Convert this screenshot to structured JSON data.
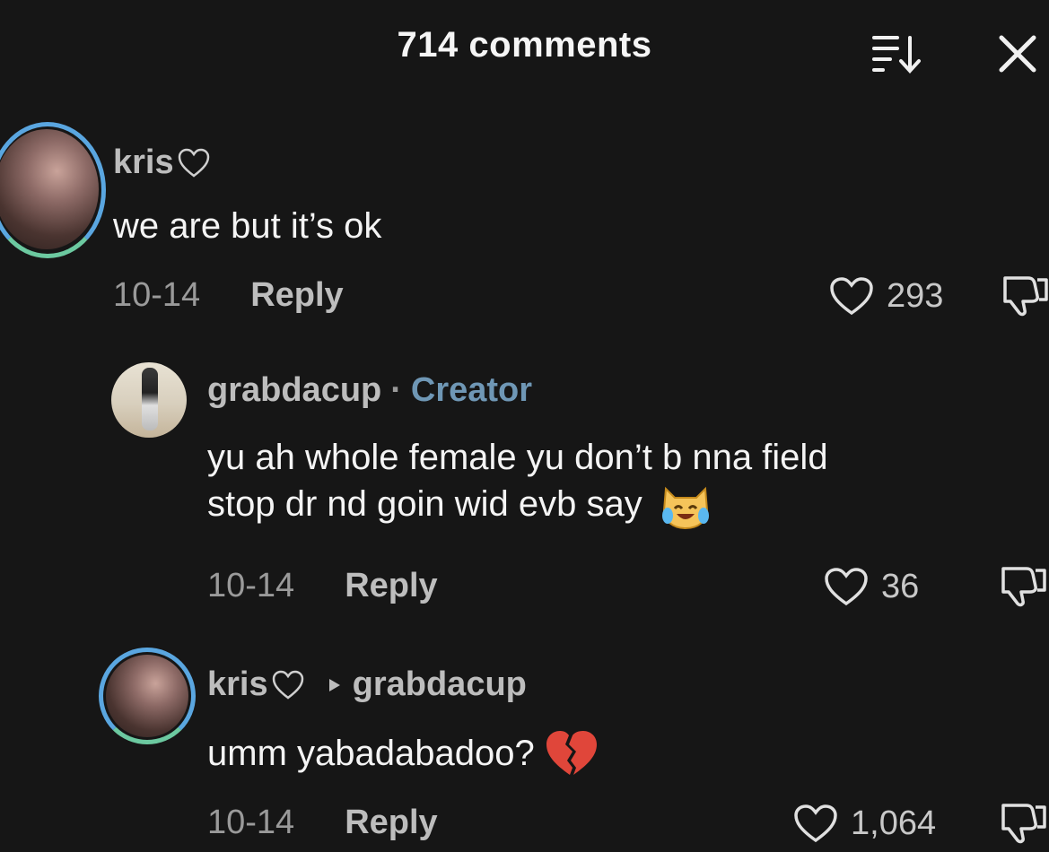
{
  "header": {
    "title": "714 comments"
  },
  "comments": [
    {
      "username": "kris",
      "body": "we are but it’s ok",
      "date": "10-14",
      "reply_label": "Reply",
      "likes": "293"
    },
    {
      "username": "grabdacup",
      "badge_sep": "·",
      "badge": "Creator",
      "body_line1": "yu ah whole female yu don’t b nna field",
      "body_line2": "stop dr nd goin wid evb say",
      "date": "10-14",
      "reply_label": "Reply",
      "likes": "36"
    },
    {
      "username": "kris",
      "reply_to": "grabdacup",
      "body": "umm yabadabadoo?",
      "date": "10-14",
      "reply_label": "Reply",
      "likes": "1,064"
    }
  ],
  "icons": {
    "sort": "sort-icon",
    "close": "close-icon",
    "heart": "heart-outline-icon",
    "dislike": "thumbs-down-icon",
    "laugh_cat": "cat-tears-of-joy-emoji",
    "broken_heart": "broken-heart-emoji"
  },
  "colors": {
    "background": "#161616",
    "creator_badge": "#6f97b5",
    "avatar_ring": "#5ab3e8"
  }
}
